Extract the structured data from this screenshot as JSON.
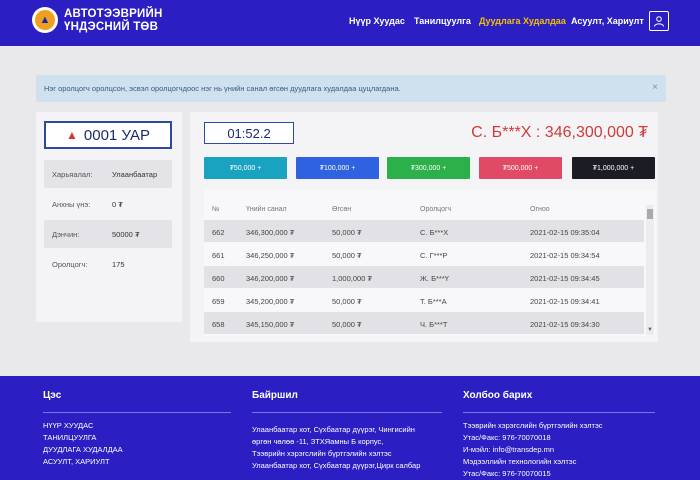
{
  "header": {
    "brand_line1": "АВТОТЭЭВРИЙН",
    "brand_line2": "ҮНДЭСНИЙ ТӨВ",
    "nav": [
      "Нүүр Хуудас",
      "Танилцуулга",
      "Дуудлага Худалдаа",
      "Асуулт, Хариулт"
    ],
    "active_nav": "Дуудлага Худалдаа",
    "user_icon": "user-icon"
  },
  "alert": {
    "text": "Нэг оролцогч оролцсон, эсвэл оролцогчдоос нэг нь үнийн санал өгсөн дуудлага худалдаа цуцлагдана.",
    "close": "×"
  },
  "lot": {
    "icon": "pin-icon",
    "number": "0001 УАР",
    "rows": [
      {
        "label": "Харьяалал:",
        "value": "Улаанбаатар"
      },
      {
        "label": "Анхны үнэ:",
        "value": "0 ₮"
      },
      {
        "label": "Дэнчин:",
        "value": "50000 ₮"
      },
      {
        "label": "Оролцогч:",
        "value": "175"
      }
    ]
  },
  "auction": {
    "timer": "01:52.2",
    "leader": "С. Б***Х : 346,300,000 ₮",
    "bid_buttons": [
      {
        "label": "₮50,000 +",
        "color": "#1aa3c0"
      },
      {
        "label": "₮100,000 +",
        "color": "#2f62e0"
      },
      {
        "label": "₮300,000 +",
        "color": "#2bb04a"
      },
      {
        "label": "₮500,000 +",
        "color": "#e04a64"
      },
      {
        "label": "₮1,000,000 +",
        "color": "#1c1c24"
      }
    ]
  },
  "bids_table": {
    "headers": [
      "№",
      "Үнийн санал",
      "Өгсөн",
      "Оролцогч",
      "Огноо"
    ],
    "rows": [
      [
        "662",
        "346,300,000 ₮",
        "50,000 ₮",
        "С. Б***Х",
        "2021-02-15 09:35:04"
      ],
      [
        "661",
        "346,250,000 ₮",
        "50,000 ₮",
        "С. Г***Р",
        "2021-02-15 09:34:54"
      ],
      [
        "660",
        "346,200,000 ₮",
        "1,000,000 ₮",
        "Ж. Б***Ү",
        "2021-02-15 09:34:45"
      ],
      [
        "659",
        "345,200,000 ₮",
        "50,000 ₮",
        "Т. Б***А",
        "2021-02-15 09:34:41"
      ],
      [
        "658",
        "345,150,000 ₮",
        "50,000 ₮",
        "Ч. Б***Т",
        "2021-02-15 09:34:30"
      ]
    ]
  },
  "footer": {
    "col1_title": "Цэс",
    "col1_items": [
      "НҮҮР ХУУДАС",
      "ТАНИЛЦУУЛГА",
      "ДУУДЛАГА ХУДАЛДАА",
      "АСУУЛТ, ХАРИУЛТ"
    ],
    "col2_title": "Байршил",
    "col2_lines": [
      "Улаанбаатар хот, Сүхбаатар дүүрэг, Чингисийн",
      "өргөн чөлөө -11, ЗТХЯамны Б корпус,",
      "Тээврийн хэрэгслийн бүртгэлийн хэлтэс",
      "Улаанбаатар хот, Сүхбаатар дүүрэг,Цирк салбар"
    ],
    "col3_title": "Холбоо барих",
    "col3_lines": [
      "Тээврийн хэрэгслийн бүртгэлийн хэлтэс",
      "Утас/Факс: 976-70070018",
      "И-мэйл: info@transdep.mn",
      "Мэдээллийн технологийн хэлтэс",
      "Утас/Факс: 976-70070015"
    ]
  },
  "colors": {
    "header_bg": "#2b1fc4",
    "active_nav": "#f2c200",
    "leader_text": "#d03a3a"
  }
}
